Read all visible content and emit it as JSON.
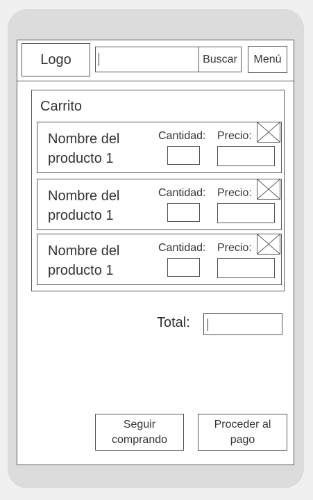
{
  "header": {
    "logo": "Logo",
    "search_value": "",
    "search_button": "Buscar",
    "menu_button": "Menú"
  },
  "cart": {
    "title": "Carrito",
    "items": [
      {
        "name_line1": "Nombre del",
        "name_line2": "producto 1",
        "quantity_label": "Cantidad:",
        "price_label": "Precio:",
        "quantity": "",
        "price": ""
      },
      {
        "name_line1": "Nombre del",
        "name_line2": "producto 1",
        "quantity_label": "Cantidad:",
        "price_label": "Precio:",
        "quantity": "",
        "price": ""
      },
      {
        "name_line1": "Nombre del",
        "name_line2": "producto 1",
        "quantity_label": "Cantidad:",
        "price_label": "Precio:",
        "quantity": "",
        "price": ""
      }
    ]
  },
  "total": {
    "label": "Total:",
    "value": ""
  },
  "actions": {
    "continue_line1": "Seguir",
    "continue_line2": "comprando",
    "checkout_line1": "Proceder al",
    "checkout_line2": "pago"
  }
}
